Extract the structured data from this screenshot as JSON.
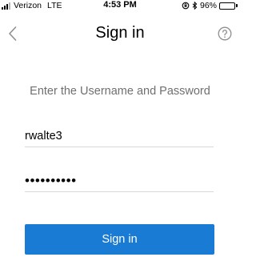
{
  "status_bar": {
    "carrier": "Verizon",
    "network": "LTE",
    "time": "4:53 PM",
    "battery": "96%",
    "battery_level": 0.96,
    "signal_bars_filled": 3,
    "signal_bars_total": 4
  },
  "nav": {
    "title": "Sign in",
    "back_icon": "chevron-left",
    "help_icon": "question-circle"
  },
  "form": {
    "instruction": "Enter the Username and Password",
    "username_value": "rwalte3",
    "password_value": "••••••••••"
  },
  "signin_button": {
    "label": "Sign in"
  },
  "colors": {
    "button_bg": "#1a7bd4",
    "button_text": "#ffffff",
    "instruction_text": "#6f6f6f",
    "divider": "#d9d9d9",
    "icon_gray": "#8e8e8e"
  }
}
